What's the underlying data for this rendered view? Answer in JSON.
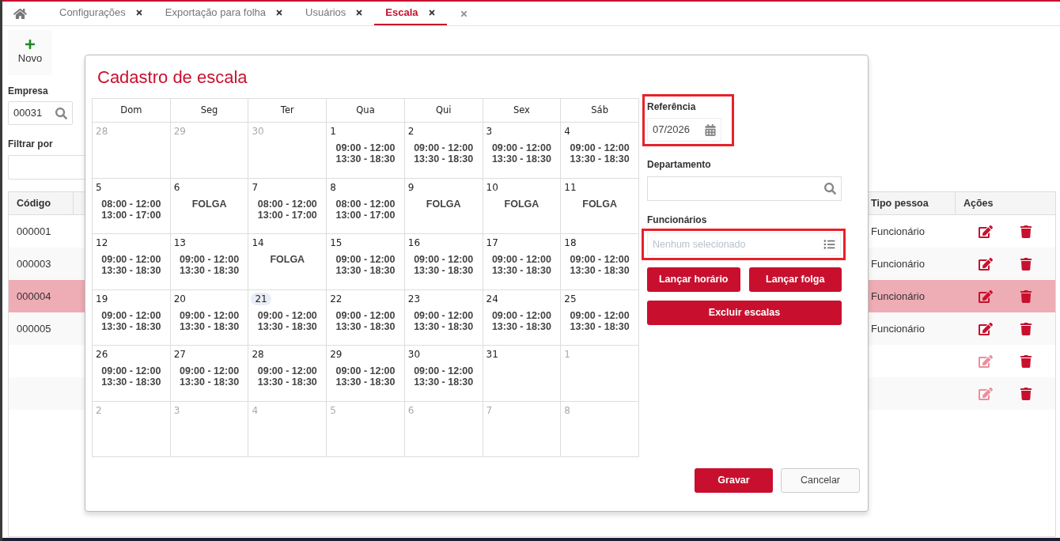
{
  "tabs": [
    {
      "label": "Configurações",
      "selected": false
    },
    {
      "label": "Exportação para folha",
      "selected": false
    },
    {
      "label": "Usuários",
      "selected": false
    },
    {
      "label": "Escala",
      "selected": true
    }
  ],
  "toolbar": {
    "new_button": "Novo"
  },
  "filters": {
    "company_label": "Empresa",
    "company_value": "00031",
    "filter_label": "Filtrar por"
  },
  "table": {
    "columns": [
      "Código",
      "Tipo pessoa",
      "Ações"
    ],
    "rows": [
      {
        "code": "000001",
        "person_type": "Funcionário",
        "selected": false,
        "edit_enabled": true
      },
      {
        "code": "000003",
        "person_type": "Funcionário",
        "selected": false,
        "edit_enabled": true
      },
      {
        "code": "000004",
        "person_type": "Funcionário",
        "selected": true,
        "edit_enabled": true
      },
      {
        "code": "000005",
        "person_type": "Funcionário",
        "selected": false,
        "edit_enabled": true
      },
      {
        "selected": false,
        "edit_enabled": false
      },
      {
        "selected": false,
        "edit_enabled": false
      }
    ]
  },
  "modal": {
    "title": "Cadastro de escala",
    "calendar": {
      "weekdays": [
        "Dom",
        "Seg",
        "Ter",
        "Qua",
        "Qui",
        "Sex",
        "Sáb"
      ],
      "weeks": [
        [
          {
            "day": "28",
            "outside": true,
            "today": false
          },
          {
            "day": "29",
            "outside": true,
            "today": false
          },
          {
            "day": "30",
            "outside": true,
            "today": false
          },
          {
            "day": "1",
            "outside": false,
            "today": false,
            "lines": [
              "09:00 - 12:00",
              "13:30 - 18:30"
            ]
          },
          {
            "day": "2",
            "outside": false,
            "today": false,
            "lines": [
              "09:00 - 12:00",
              "13:30 - 18:30"
            ]
          },
          {
            "day": "3",
            "outside": false,
            "today": false,
            "lines": [
              "09:00 - 12:00",
              "13:30 - 18:30"
            ]
          },
          {
            "day": "4",
            "outside": false,
            "today": false,
            "lines": [
              "09:00 - 12:00",
              "13:30 - 18:30"
            ]
          }
        ],
        [
          {
            "day": "5",
            "outside": false,
            "today": false,
            "lines": [
              "08:00 - 12:00",
              "13:00 - 17:00"
            ]
          },
          {
            "day": "6",
            "outside": false,
            "today": false,
            "lines": [
              "FOLGA"
            ]
          },
          {
            "day": "7",
            "outside": false,
            "today": false,
            "lines": [
              "08:00 - 12:00",
              "13:00 - 17:00"
            ]
          },
          {
            "day": "8",
            "outside": false,
            "today": false,
            "lines": [
              "08:00 - 12:00",
              "13:00 - 17:00"
            ]
          },
          {
            "day": "9",
            "outside": false,
            "today": false,
            "lines": [
              "FOLGA"
            ]
          },
          {
            "day": "10",
            "outside": false,
            "today": false,
            "lines": [
              "FOLGA"
            ]
          },
          {
            "day": "11",
            "outside": false,
            "today": false,
            "lines": [
              "FOLGA"
            ]
          }
        ],
        [
          {
            "day": "12",
            "outside": false,
            "today": false,
            "lines": [
              "09:00 - 12:00",
              "13:30 - 18:30"
            ]
          },
          {
            "day": "13",
            "outside": false,
            "today": false,
            "lines": [
              "09:00 - 12:00",
              "13:30 - 18:30"
            ]
          },
          {
            "day": "14",
            "outside": false,
            "today": false,
            "lines": [
              "FOLGA"
            ]
          },
          {
            "day": "15",
            "outside": false,
            "today": false,
            "lines": [
              "09:00 - 12:00",
              "13:30 - 18:30"
            ]
          },
          {
            "day": "16",
            "outside": false,
            "today": false,
            "lines": [
              "09:00 - 12:00",
              "13:30 - 18:30"
            ]
          },
          {
            "day": "17",
            "outside": false,
            "today": false,
            "lines": [
              "09:00 - 12:00",
              "13:30 - 18:30"
            ]
          },
          {
            "day": "18",
            "outside": false,
            "today": false,
            "lines": [
              "09:00 - 12:00",
              "13:30 - 18:30"
            ]
          }
        ],
        [
          {
            "day": "19",
            "outside": false,
            "today": false,
            "lines": [
              "09:00 - 12:00",
              "13:30 - 18:30"
            ]
          },
          {
            "day": "20",
            "outside": false,
            "today": false,
            "lines": [
              "09:00 - 12:00",
              "13:30 - 18:30"
            ]
          },
          {
            "day": "21",
            "outside": false,
            "today": true,
            "lines": [
              "09:00 - 12:00",
              "13:30 - 18:30"
            ]
          },
          {
            "day": "22",
            "outside": false,
            "today": false,
            "lines": [
              "09:00 - 12:00",
              "13:30 - 18:30"
            ]
          },
          {
            "day": "23",
            "outside": false,
            "today": false,
            "lines": [
              "09:00 - 12:00",
              "13:30 - 18:30"
            ]
          },
          {
            "day": "24",
            "outside": false,
            "today": false,
            "lines": [
              "09:00 - 12:00",
              "13:30 - 18:30"
            ]
          },
          {
            "day": "25",
            "outside": false,
            "today": false,
            "lines": [
              "09:00 - 12:00",
              "13:30 - 18:30"
            ]
          }
        ],
        [
          {
            "day": "26",
            "outside": false,
            "today": false,
            "lines": [
              "09:00 - 12:00",
              "13:30 - 18:30"
            ]
          },
          {
            "day": "27",
            "outside": false,
            "today": false,
            "lines": [
              "09:00 - 12:00",
              "13:30 - 18:30"
            ]
          },
          {
            "day": "28",
            "outside": false,
            "today": false,
            "lines": [
              "09:00 - 12:00",
              "13:30 - 18:30"
            ]
          },
          {
            "day": "29",
            "outside": false,
            "today": false,
            "lines": [
              "09:00 - 12:00",
              "13:30 - 18:30"
            ]
          },
          {
            "day": "30",
            "outside": false,
            "today": false,
            "lines": [
              "09:00 - 12:00",
              "13:30 - 18:30"
            ]
          },
          {
            "day": "31",
            "outside": false,
            "today": false
          },
          {
            "day": "1",
            "outside": true,
            "today": false
          }
        ],
        [
          {
            "day": "2",
            "outside": true,
            "today": false
          },
          {
            "day": "3",
            "outside": true,
            "today": false
          },
          {
            "day": "4",
            "outside": true,
            "today": false
          },
          {
            "day": "5",
            "outside": true,
            "today": false
          },
          {
            "day": "6",
            "outside": true,
            "today": false
          },
          {
            "day": "7",
            "outside": true,
            "today": false
          },
          {
            "day": "8",
            "outside": true,
            "today": false
          }
        ]
      ]
    },
    "reference": {
      "label": "Referência",
      "value": "07/2026",
      "annotated": true
    },
    "department": {
      "label": "Departamento"
    },
    "employees": {
      "label": "Funcionários",
      "placeholder": "Nenhum selecionado",
      "annotated": true
    },
    "actions": [
      "Lançar horário",
      "Lançar folga",
      "Excluir escalas"
    ],
    "footer": {
      "save": "Gravar",
      "cancel": "Cancelar"
    }
  }
}
